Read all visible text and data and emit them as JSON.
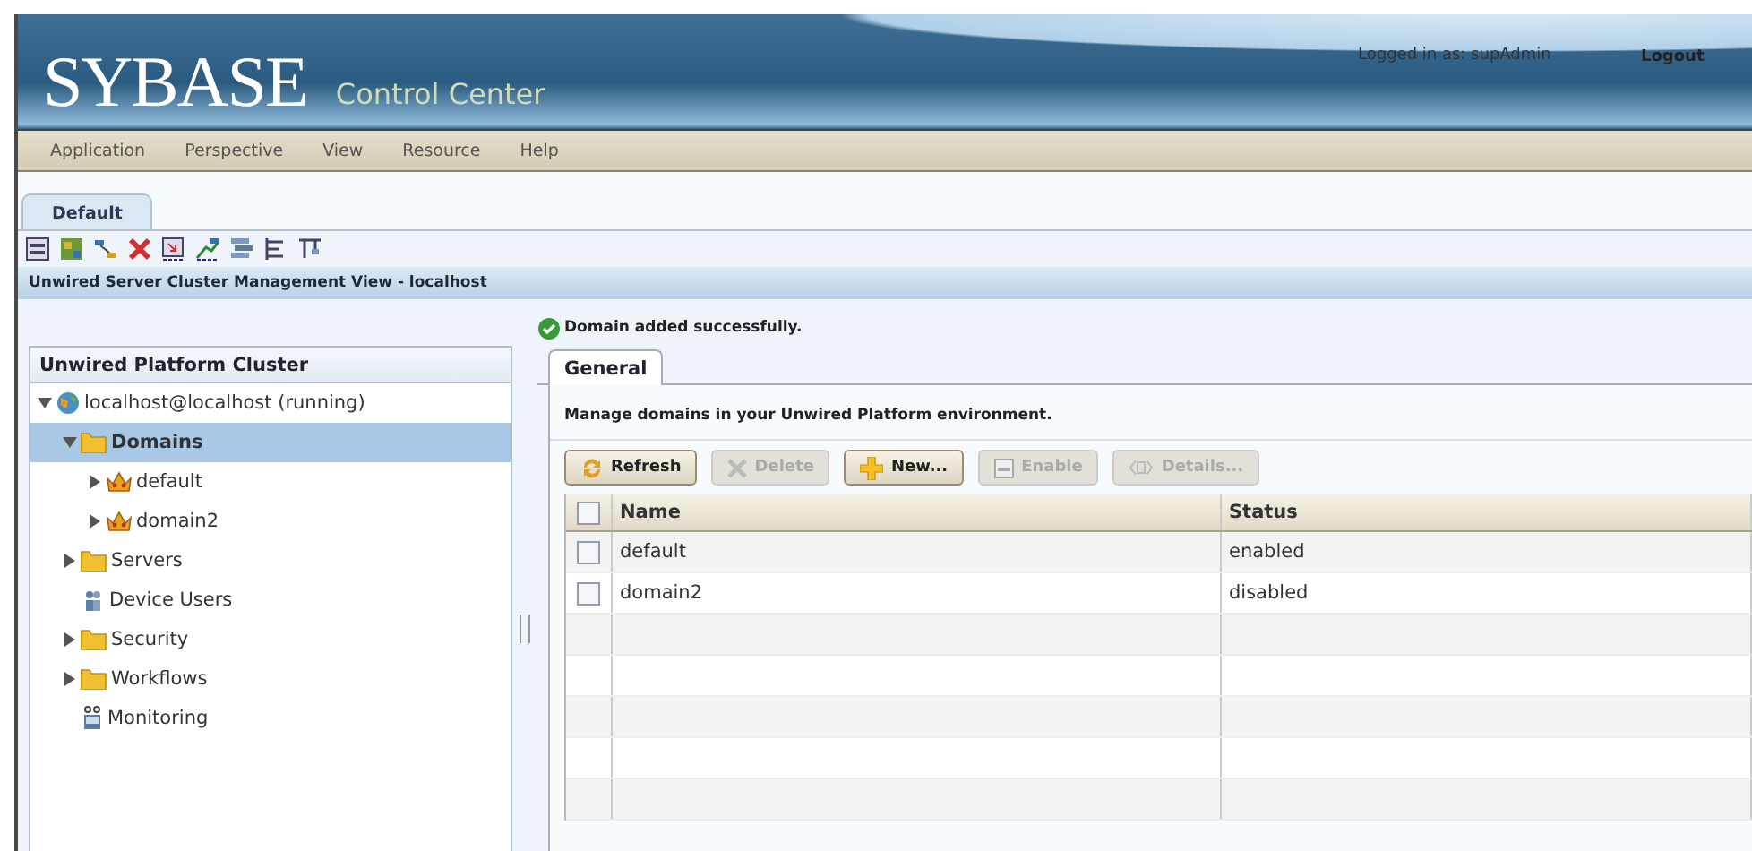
{
  "header": {
    "logo": "SYBASE",
    "product": "Control Center",
    "user": "Logged in as: supAdmin",
    "logout": "Logout"
  },
  "menu": [
    "Application",
    "Perspective",
    "View",
    "Resource",
    "Help"
  ],
  "perspective_tabs": [
    {
      "label": "Default",
      "selected": true
    }
  ],
  "view_title": "Unwired Server Cluster Management View - localhost",
  "sidebar": {
    "title": "Unwired Platform Cluster",
    "tree": [
      {
        "label": "localhost@localhost (running)",
        "kind": "host",
        "selected": false,
        "expanded": true,
        "children": [
          {
            "label": "Domains",
            "kind": "folder",
            "selected": true,
            "expanded": true,
            "children": [
              {
                "label": "default",
                "kind": "domain",
                "selected": false,
                "expanded": false
              },
              {
                "label": "domain2",
                "kind": "domain",
                "selected": false,
                "expanded": false
              }
            ]
          },
          {
            "label": "Servers",
            "kind": "folder",
            "selected": false,
            "expanded": false
          },
          {
            "label": "Device Users",
            "kind": "users",
            "selected": false
          },
          {
            "label": "Security",
            "kind": "folder",
            "selected": false,
            "expanded": false
          },
          {
            "label": "Workflows",
            "kind": "folder",
            "selected": false,
            "expanded": false
          },
          {
            "label": "Monitoring",
            "kind": "monitor",
            "selected": false
          }
        ]
      }
    ]
  },
  "message": {
    "kind": "success",
    "text": "Domain added successfully."
  },
  "tabs": [
    {
      "label": "General",
      "selected": true
    }
  ],
  "description": "Manage domains in your Unwired Platform environment.",
  "buttons": [
    {
      "label": "Refresh",
      "kind": "refresh",
      "disabled": false
    },
    {
      "label": "Delete",
      "kind": "delete",
      "disabled": true
    },
    {
      "label": "New...",
      "kind": "new",
      "disabled": false
    },
    {
      "label": "Enable",
      "kind": "enable",
      "disabled": true
    },
    {
      "label": "Details...",
      "kind": "details",
      "disabled": true
    }
  ],
  "table": {
    "columns": [
      "Name",
      "Status"
    ],
    "all_checked": false,
    "rows": [
      {
        "cells": [
          "default",
          "enabled"
        ],
        "checked": false
      },
      {
        "cells": [
          "domain2",
          "disabled"
        ],
        "checked": false
      }
    ]
  }
}
